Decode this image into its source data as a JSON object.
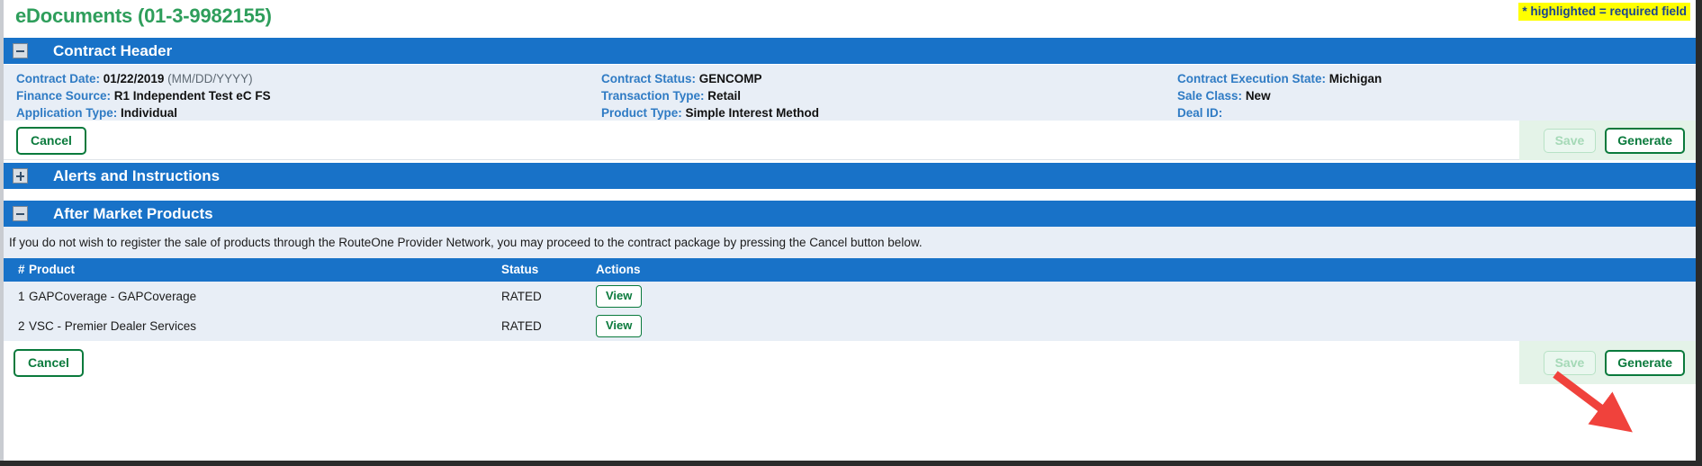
{
  "header": {
    "page_title": "eDocuments (01-3-9982155)",
    "required_field_note": "* highlighted = required field"
  },
  "sections": {
    "contract_header": {
      "title": "Contract Header",
      "expanded": true,
      "toggle_icon": "minus-icon",
      "fields": {
        "column1": [
          {
            "label": "Contract Date:",
            "value": "01/22/2019",
            "hint": "(MM/DD/YYYY)"
          },
          {
            "label": "Finance Source:",
            "value": "R1 Independent Test eC FS",
            "hint": ""
          },
          {
            "label": "Application Type:",
            "value": "Individual",
            "hint": ""
          }
        ],
        "column2": [
          {
            "label": "Contract Status:",
            "value": "GENCOMP",
            "hint": ""
          },
          {
            "label": "Transaction Type:",
            "value": "Retail",
            "hint": ""
          },
          {
            "label": "Product Type:",
            "value": "Simple Interest Method",
            "hint": ""
          }
        ],
        "column3": [
          {
            "label": "Contract Execution State:",
            "value": "Michigan",
            "hint": ""
          },
          {
            "label": "Sale Class:",
            "value": "New",
            "hint": ""
          },
          {
            "label": "Deal ID:",
            "value": "",
            "hint": ""
          }
        ]
      },
      "actions": {
        "cancel_label": "Cancel",
        "save_label": "Save",
        "save_disabled": true,
        "generate_label": "Generate"
      }
    },
    "alerts": {
      "title": "Alerts and Instructions",
      "expanded": false,
      "toggle_icon": "plus-icon"
    },
    "after_market": {
      "title": "After Market Products",
      "expanded": true,
      "toggle_icon": "minus-icon",
      "instruction": "If you do not wish to register the sale of products through the RouteOne Provider Network, you may proceed to the contract package by pressing the Cancel button below.",
      "table": {
        "columns": [
          "#",
          "Product",
          "Status",
          "Actions"
        ],
        "rows": [
          {
            "num": "1",
            "product": "GAPCoverage - GAPCoverage",
            "status": "RATED",
            "action": "View"
          },
          {
            "num": "2",
            "product": "VSC - Premier Dealer Services",
            "status": "RATED",
            "action": "View"
          }
        ]
      },
      "actions": {
        "cancel_label": "Cancel",
        "save_label": "Save",
        "save_disabled": true,
        "generate_label": "Generate"
      }
    }
  },
  "annotation": {
    "arrow_color": "#f0423c",
    "points_to": "generate-button-bottom"
  },
  "colors": {
    "section_bar": "#1872c8",
    "panel_bg": "#e8eef6",
    "title_green": "#2e9e5b",
    "button_green": "#0a7a3c",
    "label_blue": "#2f7bc4",
    "highlight_yellow": "#ffff00"
  }
}
